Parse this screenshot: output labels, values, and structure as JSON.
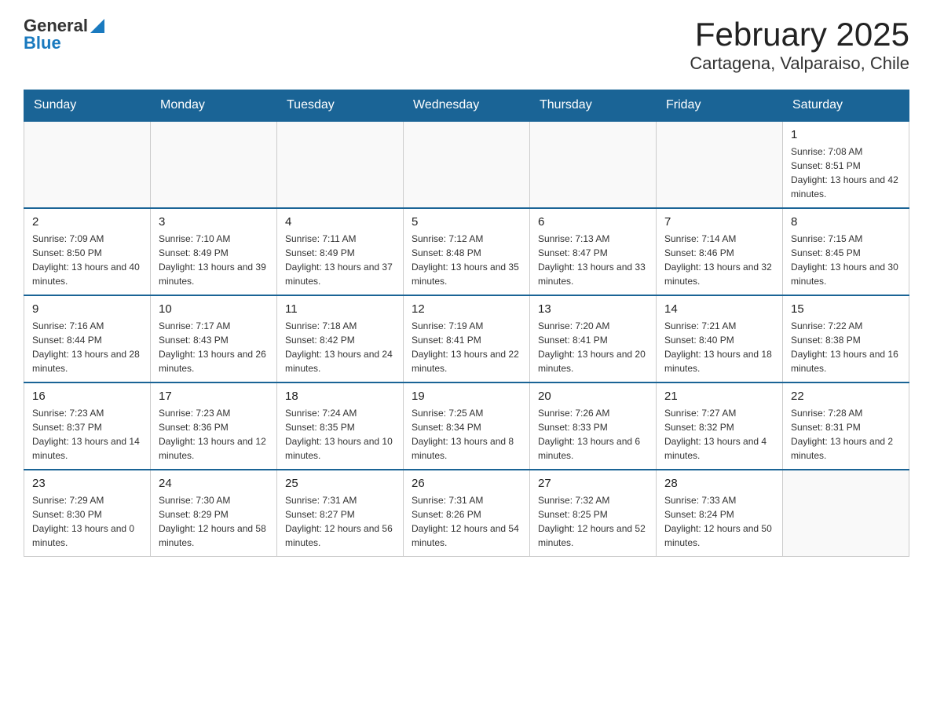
{
  "header": {
    "logo_general": "General",
    "logo_blue": "Blue",
    "month_title": "February 2025",
    "location": "Cartagena, Valparaiso, Chile"
  },
  "days_of_week": [
    "Sunday",
    "Monday",
    "Tuesday",
    "Wednesday",
    "Thursday",
    "Friday",
    "Saturday"
  ],
  "weeks": [
    [
      {
        "day": "",
        "info": ""
      },
      {
        "day": "",
        "info": ""
      },
      {
        "day": "",
        "info": ""
      },
      {
        "day": "",
        "info": ""
      },
      {
        "day": "",
        "info": ""
      },
      {
        "day": "",
        "info": ""
      },
      {
        "day": "1",
        "info": "Sunrise: 7:08 AM\nSunset: 8:51 PM\nDaylight: 13 hours and 42 minutes."
      }
    ],
    [
      {
        "day": "2",
        "info": "Sunrise: 7:09 AM\nSunset: 8:50 PM\nDaylight: 13 hours and 40 minutes."
      },
      {
        "day": "3",
        "info": "Sunrise: 7:10 AM\nSunset: 8:49 PM\nDaylight: 13 hours and 39 minutes."
      },
      {
        "day": "4",
        "info": "Sunrise: 7:11 AM\nSunset: 8:49 PM\nDaylight: 13 hours and 37 minutes."
      },
      {
        "day": "5",
        "info": "Sunrise: 7:12 AM\nSunset: 8:48 PM\nDaylight: 13 hours and 35 minutes."
      },
      {
        "day": "6",
        "info": "Sunrise: 7:13 AM\nSunset: 8:47 PM\nDaylight: 13 hours and 33 minutes."
      },
      {
        "day": "7",
        "info": "Sunrise: 7:14 AM\nSunset: 8:46 PM\nDaylight: 13 hours and 32 minutes."
      },
      {
        "day": "8",
        "info": "Sunrise: 7:15 AM\nSunset: 8:45 PM\nDaylight: 13 hours and 30 minutes."
      }
    ],
    [
      {
        "day": "9",
        "info": "Sunrise: 7:16 AM\nSunset: 8:44 PM\nDaylight: 13 hours and 28 minutes."
      },
      {
        "day": "10",
        "info": "Sunrise: 7:17 AM\nSunset: 8:43 PM\nDaylight: 13 hours and 26 minutes."
      },
      {
        "day": "11",
        "info": "Sunrise: 7:18 AM\nSunset: 8:42 PM\nDaylight: 13 hours and 24 minutes."
      },
      {
        "day": "12",
        "info": "Sunrise: 7:19 AM\nSunset: 8:41 PM\nDaylight: 13 hours and 22 minutes."
      },
      {
        "day": "13",
        "info": "Sunrise: 7:20 AM\nSunset: 8:41 PM\nDaylight: 13 hours and 20 minutes."
      },
      {
        "day": "14",
        "info": "Sunrise: 7:21 AM\nSunset: 8:40 PM\nDaylight: 13 hours and 18 minutes."
      },
      {
        "day": "15",
        "info": "Sunrise: 7:22 AM\nSunset: 8:38 PM\nDaylight: 13 hours and 16 minutes."
      }
    ],
    [
      {
        "day": "16",
        "info": "Sunrise: 7:23 AM\nSunset: 8:37 PM\nDaylight: 13 hours and 14 minutes."
      },
      {
        "day": "17",
        "info": "Sunrise: 7:23 AM\nSunset: 8:36 PM\nDaylight: 13 hours and 12 minutes."
      },
      {
        "day": "18",
        "info": "Sunrise: 7:24 AM\nSunset: 8:35 PM\nDaylight: 13 hours and 10 minutes."
      },
      {
        "day": "19",
        "info": "Sunrise: 7:25 AM\nSunset: 8:34 PM\nDaylight: 13 hours and 8 minutes."
      },
      {
        "day": "20",
        "info": "Sunrise: 7:26 AM\nSunset: 8:33 PM\nDaylight: 13 hours and 6 minutes."
      },
      {
        "day": "21",
        "info": "Sunrise: 7:27 AM\nSunset: 8:32 PM\nDaylight: 13 hours and 4 minutes."
      },
      {
        "day": "22",
        "info": "Sunrise: 7:28 AM\nSunset: 8:31 PM\nDaylight: 13 hours and 2 minutes."
      }
    ],
    [
      {
        "day": "23",
        "info": "Sunrise: 7:29 AM\nSunset: 8:30 PM\nDaylight: 13 hours and 0 minutes."
      },
      {
        "day": "24",
        "info": "Sunrise: 7:30 AM\nSunset: 8:29 PM\nDaylight: 12 hours and 58 minutes."
      },
      {
        "day": "25",
        "info": "Sunrise: 7:31 AM\nSunset: 8:27 PM\nDaylight: 12 hours and 56 minutes."
      },
      {
        "day": "26",
        "info": "Sunrise: 7:31 AM\nSunset: 8:26 PM\nDaylight: 12 hours and 54 minutes."
      },
      {
        "day": "27",
        "info": "Sunrise: 7:32 AM\nSunset: 8:25 PM\nDaylight: 12 hours and 52 minutes."
      },
      {
        "day": "28",
        "info": "Sunrise: 7:33 AM\nSunset: 8:24 PM\nDaylight: 12 hours and 50 minutes."
      },
      {
        "day": "",
        "info": ""
      }
    ]
  ]
}
